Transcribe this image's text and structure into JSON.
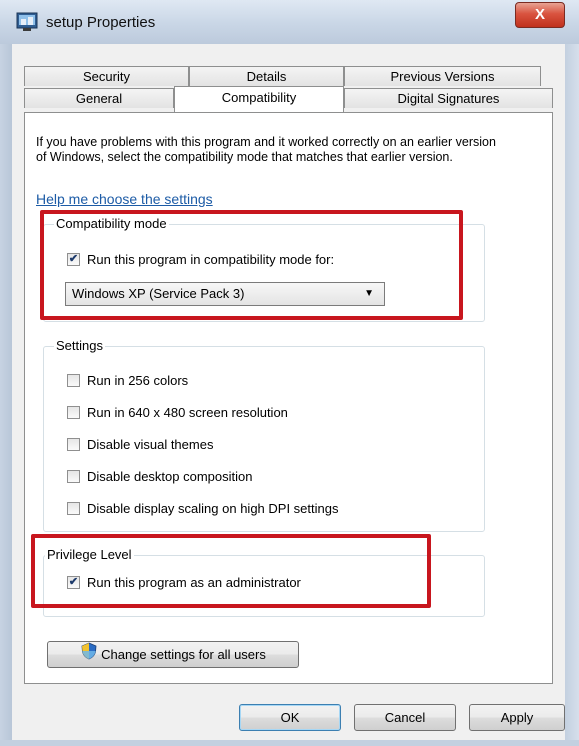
{
  "window": {
    "title": "setup Properties",
    "close_label": "X"
  },
  "tabs": [
    {
      "label": "Security"
    },
    {
      "label": "Details"
    },
    {
      "label": "Previous Versions"
    },
    {
      "label": "General"
    },
    {
      "label": "Compatibility"
    },
    {
      "label": "Digital Signatures"
    }
  ],
  "intro_text": "If you have problems with this program and it worked correctly on an earlier version of Windows, select the compatibility mode that matches that earlier version.",
  "help_link": "Help me choose the settings",
  "compat_group": {
    "title": "Compatibility mode",
    "checkbox_label": "Run this program in compatibility mode for:",
    "checked": true,
    "selected_os": "Windows XP (Service Pack 3)"
  },
  "settings_group": {
    "title": "Settings",
    "options": [
      {
        "label": "Run in 256 colors",
        "checked": false
      },
      {
        "label": "Run in 640 x 480 screen resolution",
        "checked": false
      },
      {
        "label": "Disable visual themes",
        "checked": false
      },
      {
        "label": "Disable desktop composition",
        "checked": false
      },
      {
        "label": "Disable display scaling on high DPI settings",
        "checked": false
      }
    ]
  },
  "privilege_group": {
    "title": "Privilege Level",
    "checkbox_label": "Run this program as an administrator",
    "checked": true
  },
  "change_all_users_label": "Change settings for all users",
  "buttons": {
    "ok": "OK",
    "cancel": "Cancel",
    "apply": "Apply"
  },
  "colors": {
    "highlight_box": "#c8161e",
    "link": "#1c5ba6",
    "checkmark": "#1d3a6b"
  }
}
